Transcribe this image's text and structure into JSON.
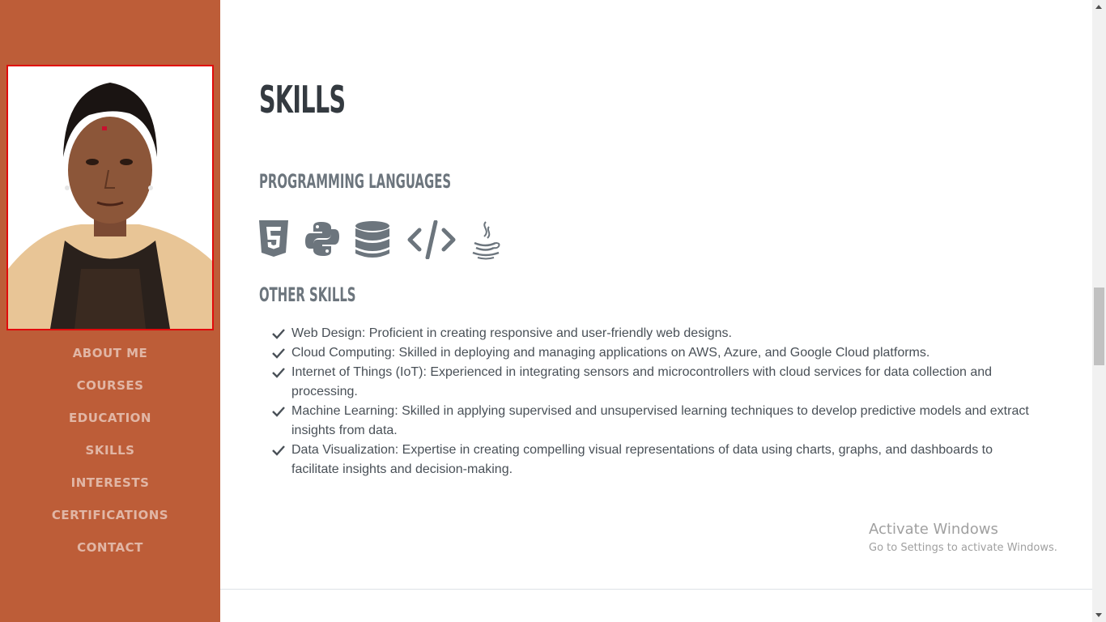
{
  "sidebar": {
    "profile_image": "profile-photo",
    "nav": [
      {
        "label": "ABOUT ME"
      },
      {
        "label": "COURSES"
      },
      {
        "label": "EDUCATION"
      },
      {
        "label": "SKILLS"
      },
      {
        "label": "INTERESTS"
      },
      {
        "label": "CERTIFICATIONS"
      },
      {
        "label": "CONTACT"
      }
    ],
    "colors": {
      "background": "#bd5d38",
      "photo_border": "#e10b0b"
    }
  },
  "main": {
    "title": "SKILLS",
    "programming_heading": "PROGRAMMING LANGUAGES",
    "programming_icons": [
      "html5-icon",
      "python-icon",
      "database-icon",
      "code-icon",
      "java-icon"
    ],
    "other_heading": "OTHER SKILLS",
    "skills": [
      "Web Design: Proficient in creating responsive and user-friendly web designs.",
      "Cloud Computing: Skilled in deploying and managing applications on AWS, Azure, and Google Cloud platforms.",
      "Internet of Things (IoT): Experienced in integrating sensors and microcontrollers with cloud services for data collection and processing.",
      "Machine Learning: Skilled in applying supervised and unsupervised learning techniques to develop predictive models and extract insights from data.",
      "Data Visualization: Expertise in creating compelling visual representations of data using charts, graphs, and dashboards to facilitate insights and decision-making."
    ]
  },
  "watermark": {
    "title": "Activate Windows",
    "subtitle": "Go to Settings to activate Windows."
  }
}
